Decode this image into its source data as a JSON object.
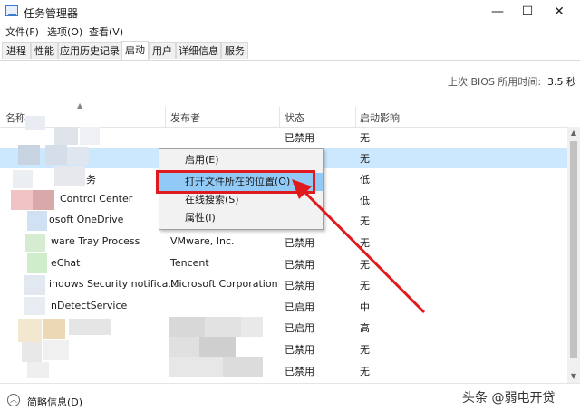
{
  "window": {
    "title": "任务管理器",
    "minimize": "—",
    "maximize": "☐",
    "close": "✕"
  },
  "menubar": [
    {
      "label": "文件(F)"
    },
    {
      "label": "选项(O)"
    },
    {
      "label": "查看(V)"
    }
  ],
  "tabs": [
    {
      "label": "进程"
    },
    {
      "label": "性能"
    },
    {
      "label": "应用历史记录"
    },
    {
      "label": "启动",
      "active": true
    },
    {
      "label": "用户"
    },
    {
      "label": "详细信息"
    },
    {
      "label": "服务"
    }
  ],
  "bios": {
    "label": "上次 BIOS 所用时间:",
    "value": "3.5 秒"
  },
  "columns": {
    "name": "名称",
    "publisher": "发布者",
    "status": "状态",
    "impact": "启动影响"
  },
  "rows": [
    {
      "name": "",
      "publisher": "",
      "status": "已禁用",
      "impact": "无"
    },
    {
      "name": "",
      "publisher": "",
      "status": "",
      "impact": "无",
      "selected": true
    },
    {
      "name": "务",
      "publisher": "",
      "status": "",
      "impact": "低"
    },
    {
      "name": "Control Center",
      "publisher": "",
      "status": "",
      "impact": "低"
    },
    {
      "name": "osoft OneDrive",
      "publisher": "",
      "status": "",
      "impact": "无"
    },
    {
      "name": "ware Tray Process",
      "publisher": "VMware, Inc.",
      "status": "已禁用",
      "impact": "无"
    },
    {
      "name": "eChat",
      "publisher": "Tencent",
      "status": "已禁用",
      "impact": "无"
    },
    {
      "name": "indows Security notifica...",
      "publisher": "Microsoft Corporation",
      "status": "已禁用",
      "impact": "无"
    },
    {
      "name": "nDetectService",
      "publisher": "",
      "status": "已启用",
      "impact": "中"
    },
    {
      "name": "",
      "publisher": "",
      "status": "已启用",
      "impact": "高"
    },
    {
      "name": "",
      "publisher": "",
      "status": "已禁用",
      "impact": "无"
    },
    {
      "name": "",
      "publisher": "",
      "status": "已禁用",
      "impact": "无"
    }
  ],
  "context_menu": [
    {
      "label": "启用(E)"
    },
    {
      "label": "打开文件所在的位置(O)",
      "highlighted": true
    },
    {
      "label": "在线搜索(S)"
    },
    {
      "label": "属性(I)"
    }
  ],
  "footer": {
    "label": "简略信息(D)"
  },
  "watermark": "头条 @弱电开贷",
  "colors": {
    "annotation_red": "#e0191c",
    "selection": "#cce8ff",
    "menu_highlight": "#91c9f7"
  }
}
